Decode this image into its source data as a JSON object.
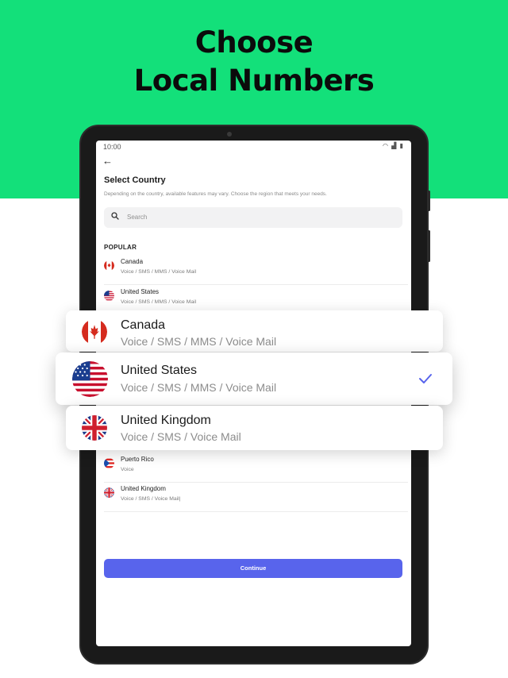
{
  "headline": {
    "line1": "Choose",
    "line2": "Local Numbers"
  },
  "colors": {
    "hero": "#13e07a",
    "accent": "#5864ec"
  },
  "status_bar": {
    "time": "10:00",
    "icons": [
      "wifi-icon",
      "signal-icon",
      "battery-icon"
    ]
  },
  "screen": {
    "title": "Select Country",
    "subtitle": "Depending on the country, available features may vary. Choose the region that meets your needs.",
    "search": {
      "placeholder": "Search"
    },
    "section_label": "POPULAR",
    "rows": [
      {
        "name": "Canada",
        "features": "Voice / SMS / MMS / Voice Mail",
        "flag": "canada-flag-icon"
      },
      {
        "name": "United States",
        "features": "Voice / SMS / MMS / Voice Mail",
        "flag": "us-flag-icon"
      },
      {
        "name": "Puerto Rico",
        "features": "Voice",
        "flag": "puerto-rico-flag-icon"
      },
      {
        "name": "United Kingdom",
        "features": "Voice / SMS / Voice Mail|",
        "flag": "uk-flag-icon"
      }
    ],
    "continue_label": "Continue"
  },
  "cards": [
    {
      "name": "Canada",
      "features": "Voice / SMS / MMS / Voice Mail",
      "flag": "canada-flag-icon",
      "selected": false
    },
    {
      "name": "United States",
      "features": "Voice / SMS / MMS / Voice Mail",
      "flag": "us-flag-icon",
      "selected": true
    },
    {
      "name": "United Kingdom",
      "features": "Voice / SMS / Voice Mail",
      "flag": "uk-flag-icon",
      "selected": false
    }
  ]
}
